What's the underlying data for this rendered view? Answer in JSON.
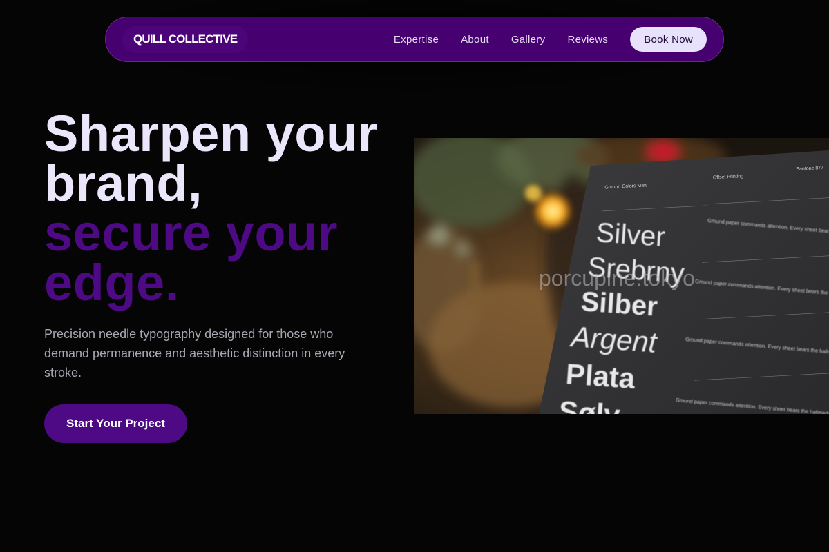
{
  "nav": {
    "brand": "QUILL COLLECTIVE",
    "links": [
      "Expertise",
      "About",
      "Gallery",
      "Reviews"
    ],
    "book_label": "Book Now"
  },
  "hero": {
    "line1": "Sharpen your",
    "line2": "brand,",
    "line3": "secure your",
    "line4": "edge.",
    "subtext": "Precision needle typography designed for those who demand permanence and aesthetic distinction in every stroke.",
    "cta_label": "Start Your Project"
  },
  "photo": {
    "card_header_left": "Gmund Colors Matt",
    "card_header_mid": "Offset Printing",
    "card_header_right": "Pantone 877",
    "words": [
      "Silver",
      "Srebrny",
      "Silber",
      "Argent",
      "Plata",
      "Sølv"
    ],
    "watermark": "porcupine.tokyo",
    "body_text": "Gmund paper commands attention. Every sheet bears the hallmark of innovation, craftsmanship and an unwavering commitment to quality."
  },
  "colors": {
    "background": "#050505",
    "nav_bg": "#46006f",
    "accent": "#4d0a84",
    "headline_light": "#ece6fb",
    "button_light": "#e8e1fb"
  }
}
